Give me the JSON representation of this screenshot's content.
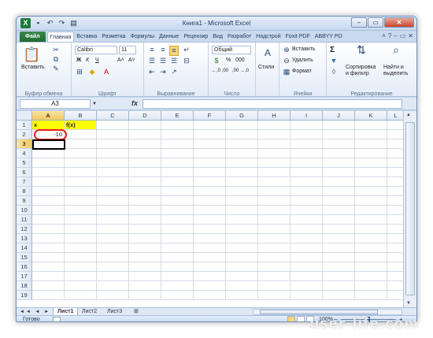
{
  "title": "Книга1  -  Microsoft Excel",
  "window_buttons": [
    "–",
    "▭",
    "✕"
  ],
  "qat_icons": [
    "save-icon",
    "undo-icon",
    "redo-icon",
    "print-icon"
  ],
  "tabs": [
    "Файл",
    "Главная",
    "Вставка",
    "Разметка",
    "Формулы",
    "Данные",
    "Рецензир",
    "Вид",
    "Разработ",
    "Надстрой",
    "Foxit PDF",
    "ABBYY PD"
  ],
  "ribbon": {
    "clipboard": {
      "paste": "Вставить",
      "label": "Буфер обмена"
    },
    "font": {
      "name": "Calibri",
      "size": "11",
      "bold": "Ж",
      "italic": "К",
      "underline": "Ч",
      "grow": "A˄",
      "shrink": "A˅",
      "label": "Шрифт"
    },
    "alignment": {
      "label": "Выравнивание"
    },
    "number": {
      "format": "Общий",
      "percent": "%",
      "thousands": "000",
      "inc": "←,0 ,00",
      "dec": ",00 →,0",
      "label": "Число"
    },
    "styles": {
      "label": "Стили"
    },
    "cells": {
      "insert": "Вставить",
      "delete": "Удалить",
      "format": "Формат",
      "label": "Ячейки"
    },
    "editing": {
      "sum": "Σ",
      "sort": "Сортировка и фильтр",
      "find": "Найти и выделить",
      "label": "Редактирование"
    }
  },
  "formula_bar": {
    "name_box": "A3",
    "fx": "fx",
    "value": ""
  },
  "columns": [
    "A",
    "B",
    "C",
    "D",
    "E",
    "F",
    "G",
    "H",
    "I",
    "J",
    "K",
    "L"
  ],
  "rows": [
    "1",
    "2",
    "3",
    "4",
    "5",
    "6",
    "7",
    "8",
    "9",
    "10",
    "11",
    "12",
    "13",
    "14",
    "15",
    "16",
    "17",
    "18",
    "19"
  ],
  "cells": {
    "A1": "x",
    "B1": "f(x)",
    "A2": "-10"
  },
  "active_cell": "A3",
  "sheets": [
    "Лист1",
    "Лист2",
    "Лист3"
  ],
  "active_sheet": "Лист1",
  "status": {
    "ready": "Готово",
    "zoom": "100%",
    "zoom_minus": "−",
    "zoom_plus": "+"
  },
  "watermark": "user-life.com",
  "colors": {
    "file_tab": "#206b33",
    "header_highlight": "#f3c85e",
    "cell_fill": "#ffff00",
    "annotation": "#e2201a"
  }
}
